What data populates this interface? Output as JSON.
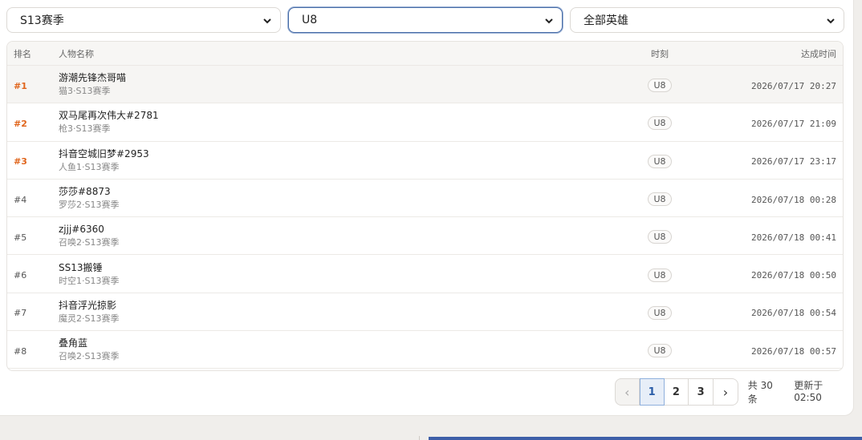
{
  "filters": {
    "season": "S13赛季",
    "tick": "U8",
    "hero": "全部英雄"
  },
  "table": {
    "headers": {
      "rank": "排名",
      "name": "人物名称",
      "tick": "时刻",
      "time": "达成时间"
    },
    "rows": [
      {
        "rank": "#1",
        "name": "游潮先锋杰哥喵",
        "hero": "猫3",
        "season": "S13赛季",
        "tick": "U8",
        "time": "2026/07/17 20:27"
      },
      {
        "rank": "#2",
        "name": "双马尾再次伟大#2781",
        "hero": "枪3",
        "season": "S13赛季",
        "tick": "U8",
        "time": "2026/07/17 21:09"
      },
      {
        "rank": "#3",
        "name": "抖音空城旧梦#2953",
        "hero": "人鱼1",
        "season": "S13赛季",
        "tick": "U8",
        "time": "2026/07/17 23:17"
      },
      {
        "rank": "#4",
        "name": "莎莎#8873",
        "hero": "罗莎2",
        "season": "S13赛季",
        "tick": "U8",
        "time": "2026/07/18 00:28"
      },
      {
        "rank": "#5",
        "name": "zjjj#6360",
        "hero": "召唤2",
        "season": "S13赛季",
        "tick": "U8",
        "time": "2026/07/18 00:41"
      },
      {
        "rank": "#6",
        "name": "SS13搬锤",
        "hero": "时空1",
        "season": "S13赛季",
        "tick": "U8",
        "time": "2026/07/18 00:50"
      },
      {
        "rank": "#7",
        "name": "抖音浮光掠影",
        "hero": "魔灵2",
        "season": "S13赛季",
        "tick": "U8",
        "time": "2026/07/18 00:54"
      },
      {
        "rank": "#8",
        "name": "叠角蓝",
        "hero": "召唤2",
        "season": "S13赛季",
        "tick": "U8",
        "time": "2026/07/18 00:57"
      }
    ]
  },
  "pagination": {
    "prev": "‹",
    "pages": [
      "1",
      "2",
      "3"
    ],
    "current": "1",
    "next": "›",
    "total": "共 30 条",
    "updated": "更新于 02:50"
  },
  "colors": {
    "top_rank": "#e0651c",
    "accent": "#4a6ea8"
  }
}
